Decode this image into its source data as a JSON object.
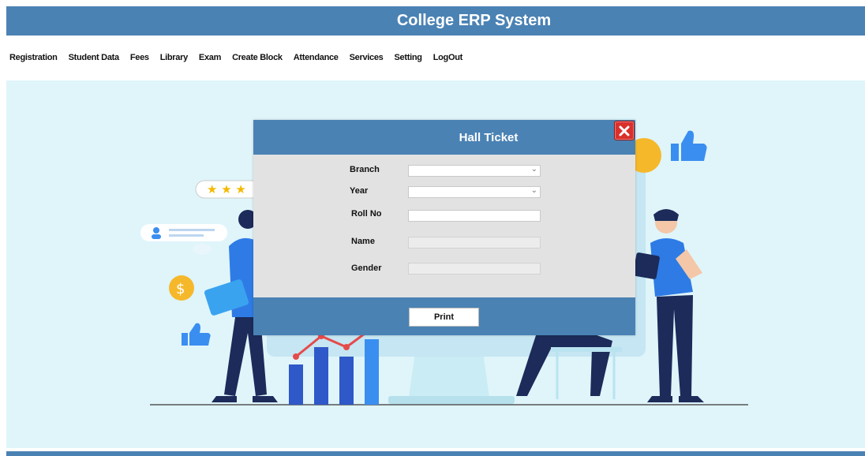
{
  "app": {
    "title": "College ERP System"
  },
  "menu": [
    {
      "label": "Registration"
    },
    {
      "label": "Student Data"
    },
    {
      "label": "Fees"
    },
    {
      "label": "Library"
    },
    {
      "label": "Exam"
    },
    {
      "label": "Create Block"
    },
    {
      "label": "Attendance"
    },
    {
      "label": "Services"
    },
    {
      "label": "Setting"
    },
    {
      "label": "LogOut"
    }
  ],
  "dialog": {
    "title": "Hall Ticket",
    "fields": {
      "branch": {
        "label": "Branch",
        "value": ""
      },
      "year": {
        "label": "Year",
        "value": ""
      },
      "roll_no": {
        "label": "Roll No",
        "value": ""
      },
      "name": {
        "label": "Name",
        "value": ""
      },
      "gender": {
        "label": "Gender",
        "value": ""
      }
    },
    "print_label": "Print"
  },
  "icons": {
    "close": "close-icon",
    "dropdown": "chevron-down-icon"
  },
  "colors": {
    "header": "#4a82b4",
    "background": "#dff5fa",
    "dialog_body": "#e2e2e2",
    "close_button": "#d9302c"
  }
}
